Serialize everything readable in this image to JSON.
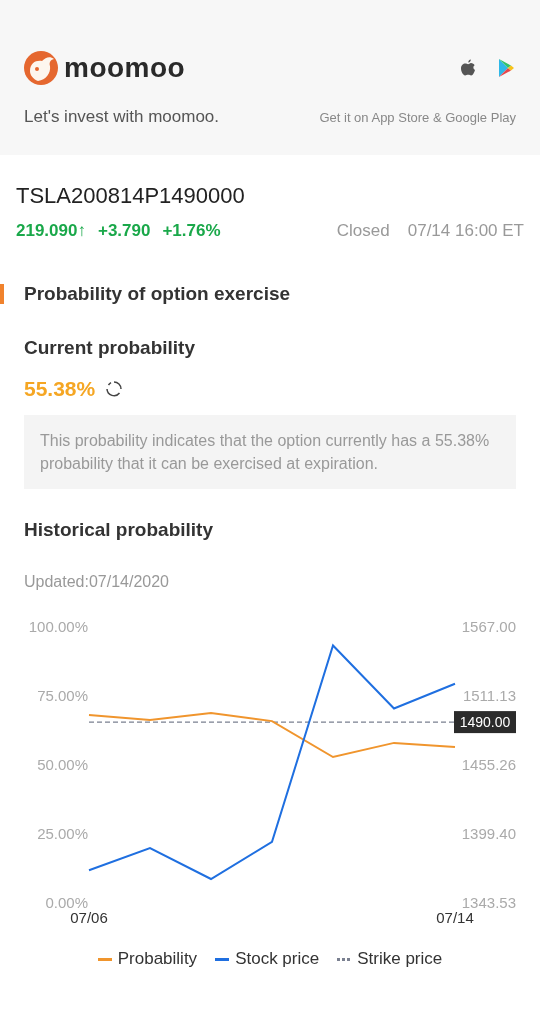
{
  "banner": {
    "brand": "moomoo",
    "tagline": "Let's invest with moomoo.",
    "stores": "Get it on App Store & Google Play"
  },
  "quote": {
    "symbol": "TSLA200814P1490000",
    "price": "219.090",
    "arrow": "↑",
    "change": "+3.790",
    "change_pct": "+1.76%",
    "status": "Closed",
    "time": "07/14 16:00 ET"
  },
  "section_title": "Probability of option exercise",
  "current": {
    "heading": "Current probability",
    "value": "55.38%",
    "note": "This probability indicates that the option currently has a 55.38% probability that it can be exercised at expiration."
  },
  "historical": {
    "heading": "Historical probability",
    "updated": "Updated:07/14/2020",
    "chart_data": {
      "type": "line",
      "categories": [
        "07/06",
        null,
        null,
        null,
        null,
        null,
        "07/14"
      ],
      "ylim": [
        0,
        100
      ],
      "yticks": [
        {
          "value": 0,
          "label": "0.00%"
        },
        {
          "value": 25,
          "label": "25.00%"
        },
        {
          "value": 50,
          "label": "50.00%"
        },
        {
          "value": 75,
          "label": "75.00%"
        },
        {
          "value": 100,
          "label": "100.00%"
        }
      ],
      "y2lim": [
        1343.53,
        1567
      ],
      "y2ticks": [
        {
          "value": 1343.53,
          "label": "1343.53"
        },
        {
          "value": 1399.4,
          "label": "1399.40"
        },
        {
          "value": 1455.26,
          "label": "1455.26"
        },
        {
          "value": 1511.13,
          "label": "1511.13"
        },
        {
          "value": 1567,
          "label": "1567.00"
        }
      ],
      "series": [
        {
          "name": "Probability",
          "color": "#f0952d",
          "values": [
            68.1,
            66.3,
            68.8,
            65.9,
            52.9,
            58.0,
            56.5
          ]
        },
        {
          "name": "Stock price",
          "color": "#1f6fe0",
          "axis": "y2",
          "values": [
            1370,
            1388,
            1363,
            1393,
            1552,
            1501,
            1521
          ]
        }
      ],
      "ref_lines": [
        {
          "color": "#7a8090",
          "axis": "y2",
          "value": 1490,
          "label": "1490.00"
        }
      ]
    },
    "strike_legend": "Strike price"
  }
}
